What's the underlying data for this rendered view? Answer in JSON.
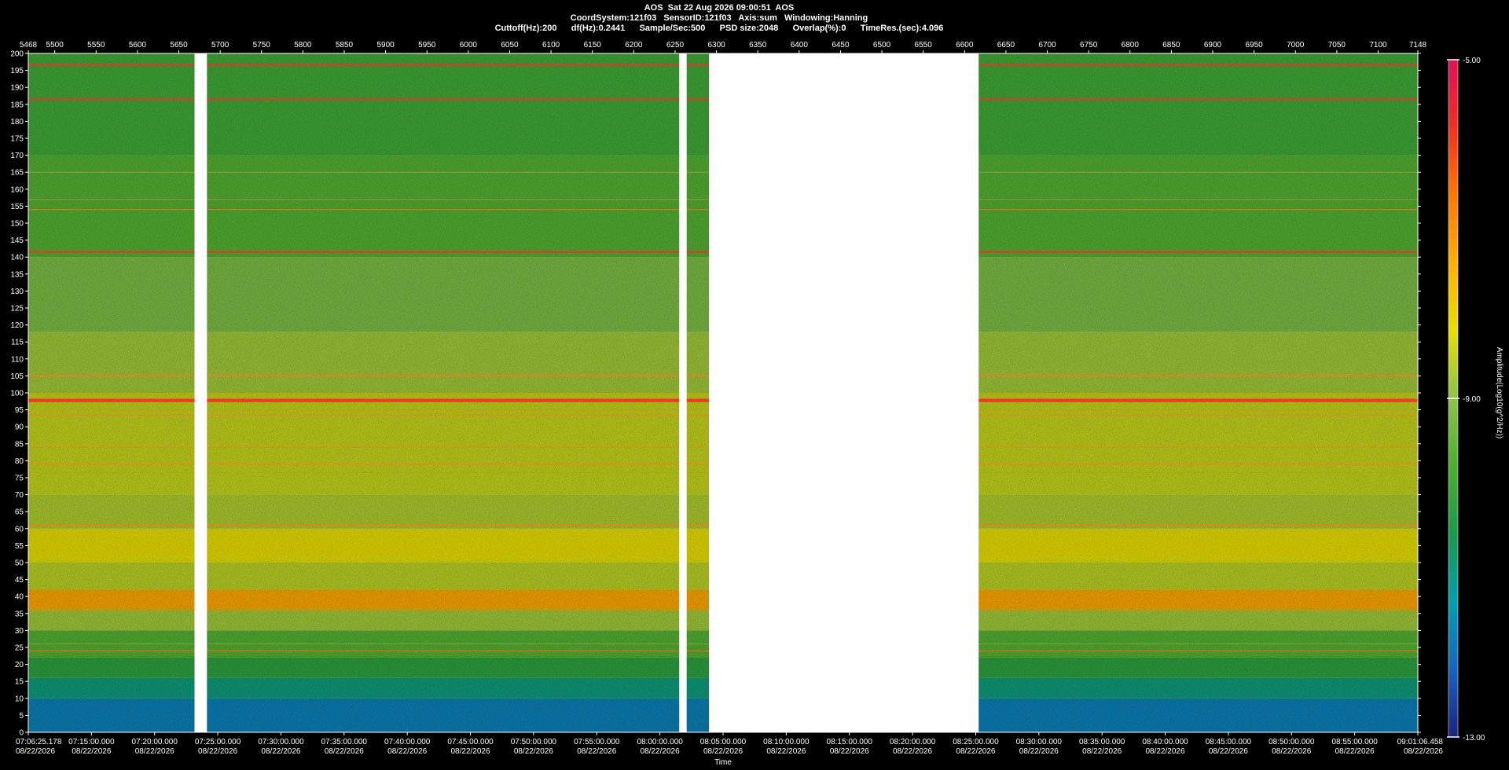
{
  "header": {
    "line1": "AOS  Sat 22 Aug 2026 09:00:51  AOS",
    "line2": "CoordSystem:121f03   SensorID:121f03   Axis:sum   Windowing:Hanning",
    "line3": "Cuttoff(Hz):200      df(Hz):0.2441      Sample/Sec:500      PSD size:2048      Overlap(%):0      TimeRes.(sec):4.096"
  },
  "chart_data": {
    "type": "heatmap",
    "title": "AOS  Sat 22 Aug 2026 09:00:51  AOS",
    "xlabel": "Time",
    "ylabel": "",
    "colorbar_label": "Amplitude(Log10(g^2/Hz))",
    "colorbar_ticks": [
      "-5.00",
      "-9.00",
      "-13.00"
    ],
    "colorbar_range": [
      -13,
      -5
    ],
    "colorscale": [
      "#1a237e",
      "#1565c0",
      "#00a0b0",
      "#1b9a4a",
      "#4caf30",
      "#8bc34a",
      "#e8e000",
      "#ffb000",
      "#ff7800",
      "#f03020",
      "#e0105a"
    ],
    "ylim": [
      0,
      200
    ],
    "yticks": [
      "0",
      "5",
      "10",
      "15",
      "20",
      "25",
      "30",
      "35",
      "40",
      "45",
      "50",
      "55",
      "60",
      "65",
      "70",
      "75",
      "80",
      "85",
      "90",
      "95",
      "100",
      "105",
      "110",
      "115",
      "120",
      "125",
      "130",
      "135",
      "140",
      "145",
      "150",
      "155",
      "160",
      "165",
      "170",
      "175",
      "180",
      "185",
      "190",
      "195",
      "200"
    ],
    "top_axis_range": [
      5468,
      7148
    ],
    "top_ticks": [
      "5468",
      "5500",
      "5550",
      "5600",
      "5650",
      "5700",
      "5750",
      "5800",
      "5850",
      "5900",
      "5950",
      "6000",
      "6050",
      "6100",
      "6150",
      "6200",
      "6250",
      "6300",
      "6350",
      "6400",
      "6450",
      "6500",
      "6550",
      "6600",
      "6650",
      "6700",
      "6750",
      "6800",
      "6850",
      "6900",
      "6950",
      "7000",
      "7050",
      "7100",
      "7148"
    ],
    "time_ticks": [
      {
        "time": "07:06:25.178",
        "date": "08/22/2026"
      },
      {
        "time": "07:15:00.000",
        "date": "08/22/2026"
      },
      {
        "time": "07:20:00.000",
        "date": "08/22/2026"
      },
      {
        "time": "07:25:00.000",
        "date": "08/22/2026"
      },
      {
        "time": "07:30:00.000",
        "date": "08/22/2026"
      },
      {
        "time": "07:35:00.000",
        "date": "08/22/2026"
      },
      {
        "time": "07:40:00.000",
        "date": "08/22/2026"
      },
      {
        "time": "07:45:00.000",
        "date": "08/22/2026"
      },
      {
        "time": "07:50:00.000",
        "date": "08/22/2026"
      },
      {
        "time": "07:55:00.000",
        "date": "08/22/2026"
      },
      {
        "time": "08:00:00.000",
        "date": "08/22/2026"
      },
      {
        "time": "08:05:00.000",
        "date": "08/22/2026"
      },
      {
        "time": "08:10:00.000",
        "date": "08/22/2026"
      },
      {
        "time": "08:15:00.000",
        "date": "08/22/2026"
      },
      {
        "time": "08:20:00.000",
        "date": "08/22/2026"
      },
      {
        "time": "08:25:00.000",
        "date": "08/22/2026"
      },
      {
        "time": "08:30:00.000",
        "date": "08/22/2026"
      },
      {
        "time": "08:35:00.000",
        "date": "08/22/2026"
      },
      {
        "time": "08:40:00.000",
        "date": "08/22/2026"
      },
      {
        "time": "08:45:00.000",
        "date": "08/22/2026"
      },
      {
        "time": "08:50:00.000",
        "date": "08/22/2026"
      },
      {
        "time": "08:55:00.000",
        "date": "08/22/2026"
      },
      {
        "time": "09:01:06.458",
        "date": "08/22/2026"
      }
    ],
    "data_gaps": [
      [
        5669,
        5684
      ],
      [
        6255,
        6264
      ],
      [
        6291,
        6617
      ]
    ],
    "band_profile": [
      {
        "y_hz": [
          0,
          10
        ],
        "amplitude": -11.8
      },
      {
        "y_hz": [
          10,
          16
        ],
        "amplitude": -11.0
      },
      {
        "y_hz": [
          16,
          22
        ],
        "amplitude": -10.3
      },
      {
        "y_hz": [
          22,
          30
        ],
        "amplitude": -9.7
      },
      {
        "y_hz": [
          30,
          36
        ],
        "amplitude": -8.8
      },
      {
        "y_hz": [
          36,
          42
        ],
        "amplitude": -7.3
      },
      {
        "y_hz": [
          42,
          50
        ],
        "amplitude": -8.6
      },
      {
        "y_hz": [
          50,
          60
        ],
        "amplitude": -8.2
      },
      {
        "y_hz": [
          60,
          70
        ],
        "amplitude": -8.7
      },
      {
        "y_hz": [
          70,
          100
        ],
        "amplitude": -8.5
      },
      {
        "y_hz": [
          100,
          118
        ],
        "amplitude": -8.8
      },
      {
        "y_hz": [
          118,
          140
        ],
        "amplitude": -9.2
      },
      {
        "y_hz": [
          140,
          170
        ],
        "amplitude": -9.7
      },
      {
        "y_hz": [
          170,
          200
        ],
        "amplitude": -10.0
      }
    ],
    "tonal_lines_hz": [
      196.5,
      186.5,
      165,
      157,
      154,
      141.5,
      105,
      98,
      97.5,
      95,
      93.5,
      84,
      79,
      76.5,
      61,
      26,
      24
    ],
    "grid": false
  }
}
